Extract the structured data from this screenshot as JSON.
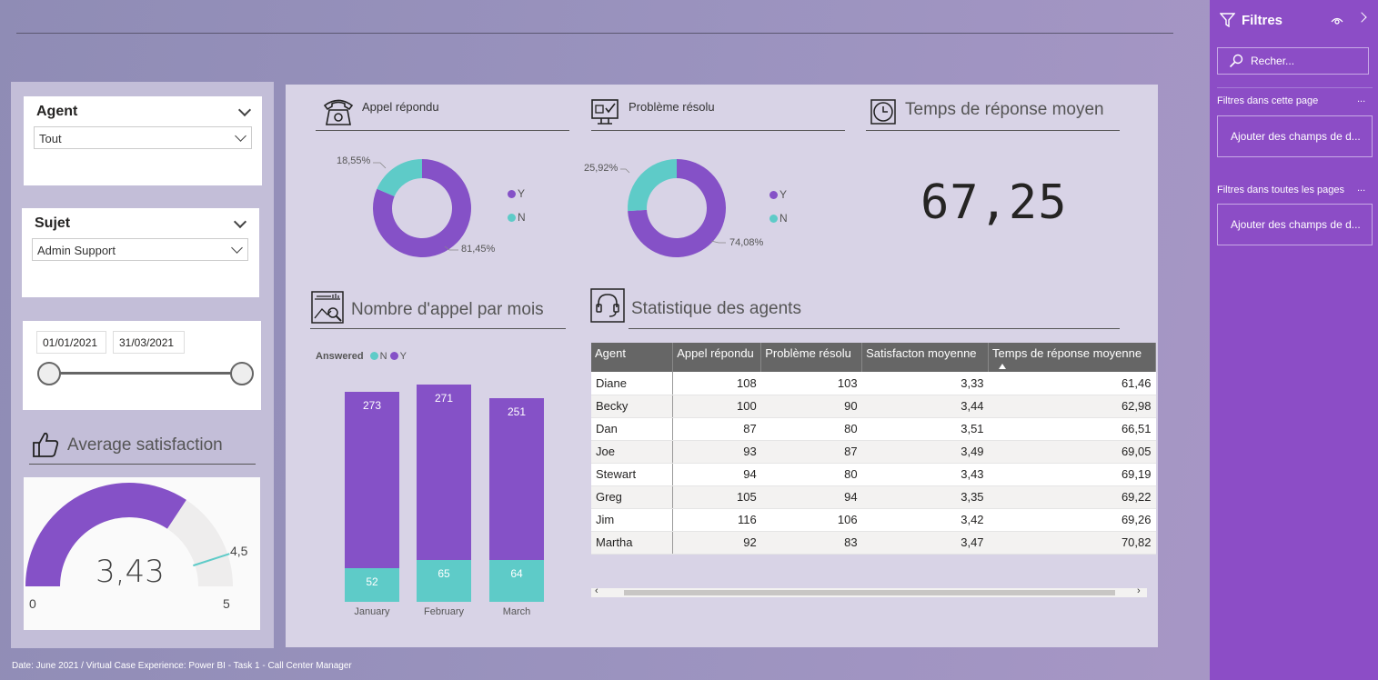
{
  "footer": "Date: June 2021 / Virtual Case Experience: Power BI - Task 1 - Call Center Manager",
  "colors": {
    "purple": "#8551c7",
    "teal": "#5ecbc8",
    "filter_pane": "#8c4dc6"
  },
  "slicers": {
    "agent": {
      "title": "Agent",
      "value": "Tout"
    },
    "sujet": {
      "title": "Sujet",
      "value": "Admin Support"
    },
    "date": {
      "start": "01/01/2021",
      "end": "31/03/2021"
    }
  },
  "satisfaction": {
    "title": "Average satisfaction",
    "value": "3,43",
    "min": "0",
    "max": "5",
    "target": "4,5",
    "value_num": 3.43,
    "max_num": 5,
    "target_num": 4.5
  },
  "appel": {
    "title": "Appel répondu",
    "y_pct": "81,45%",
    "n_pct": "18,55%",
    "y_val": 81.45,
    "n_val": 18.55,
    "legend_y": "Y",
    "legend_n": "N"
  },
  "probleme": {
    "title": "Problème résolu",
    "y_pct": "74,08%",
    "n_pct": "25,92%",
    "y_val": 74.08,
    "n_val": 25.92,
    "legend_y": "Y",
    "legend_n": "N"
  },
  "temps": {
    "title": "Temps de réponse moyen",
    "value": "67,25"
  },
  "monthly": {
    "title": "Nombre d'appel par mois",
    "legend_title": "Answered",
    "legend_n": "N",
    "legend_y": "Y"
  },
  "chart_data": {
    "type": "bar",
    "categories": [
      "January",
      "February",
      "March"
    ],
    "series": [
      {
        "name": "Y",
        "values": [
          273,
          271,
          251
        ]
      },
      {
        "name": "N",
        "values": [
          52,
          65,
          64
        ]
      }
    ]
  },
  "stats": {
    "title": "Statistique des agents",
    "columns": [
      "Agent",
      "Appel répondu",
      "Problème résolu",
      "Satisfacton moyenne",
      "Temps de réponse moyenne"
    ],
    "rows": [
      [
        "Diane",
        "108",
        "103",
        "3,33",
        "61,46"
      ],
      [
        "Becky",
        "100",
        "90",
        "3,44",
        "62,98"
      ],
      [
        "Dan",
        "87",
        "80",
        "3,51",
        "66,51"
      ],
      [
        "Joe",
        "93",
        "87",
        "3,49",
        "69,05"
      ],
      [
        "Stewart",
        "94",
        "80",
        "3,43",
        "69,19"
      ],
      [
        "Greg",
        "105",
        "94",
        "3,35",
        "69,22"
      ],
      [
        "Jim",
        "116",
        "106",
        "3,42",
        "69,26"
      ],
      [
        "Martha",
        "92",
        "83",
        "3,47",
        "70,82"
      ]
    ]
  },
  "filters": {
    "title": "Filtres",
    "search_placeholder": "Recher...",
    "section_page": "Filtres dans cette page",
    "section_all": "Filtres dans toutes les pages",
    "add_page": "Ajouter des champs de d...",
    "add_all": "Ajouter des champs de d...",
    "more": "..."
  }
}
